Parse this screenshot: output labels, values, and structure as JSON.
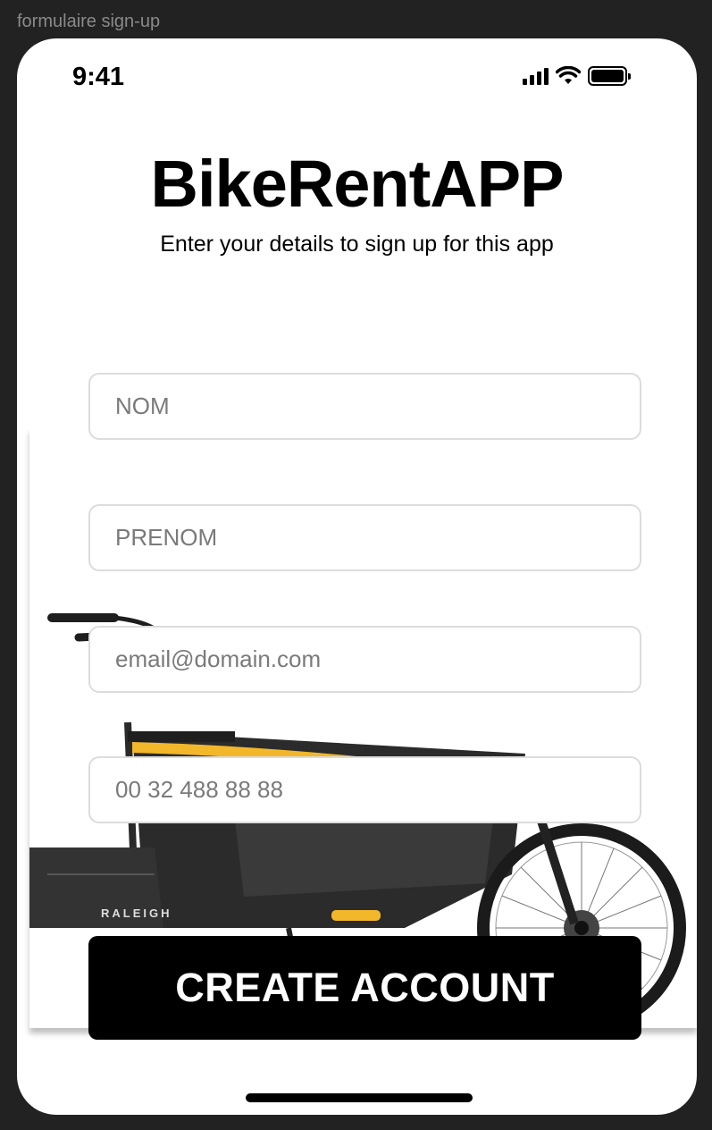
{
  "frame_label": "formulaire sign-up",
  "status_bar": {
    "time": "9:41",
    "icons": [
      "signal-icon",
      "wifi-icon",
      "battery-icon"
    ]
  },
  "header": {
    "title": "BikeRentAPP",
    "subtitle": "Enter your details to sign up for this app"
  },
  "form": {
    "nom_placeholder": "NOM",
    "prenom_placeholder": "PRENOM",
    "email_placeholder": "email@domain.com",
    "phone_placeholder": "00 32 488 88 88",
    "submit_label": "CREATE ACCOUNT"
  },
  "background_image": {
    "brand_text": "RALEIGH",
    "colors": {
      "frame": "#2b2b2b",
      "accent_bar": "#f2b72a"
    }
  },
  "colors": {
    "canvas": "#222222",
    "screen": "#ffffff",
    "button": "#000000",
    "field_border": "#dcdcdc"
  }
}
